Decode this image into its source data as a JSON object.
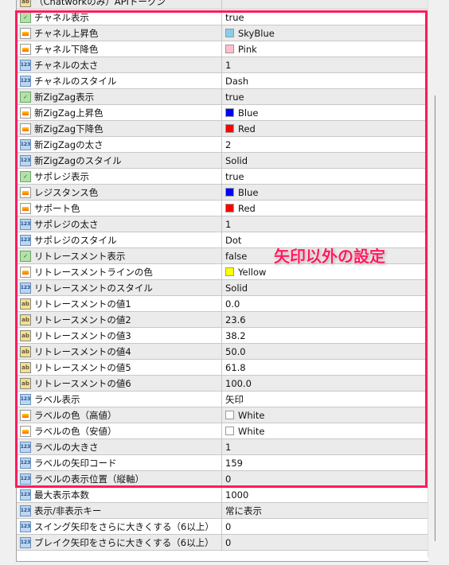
{
  "rows": [
    {
      "type": "ab",
      "name": "（Chatworkのみ）APIトークン",
      "value": ""
    },
    {
      "type": "bool",
      "name": "チャネル表示",
      "value": "true"
    },
    {
      "type": "color",
      "name": "チャネル上昇色",
      "value": "SkyBlue",
      "swatch": "#87ceeb"
    },
    {
      "type": "color",
      "name": "チャネル下降色",
      "value": "Pink",
      "swatch": "#ffc0cb"
    },
    {
      "type": "num",
      "name": "チャネルの太さ",
      "value": "1"
    },
    {
      "type": "num",
      "name": "チャネルのスタイル",
      "value": "Dash"
    },
    {
      "type": "bool",
      "name": "新ZigZag表示",
      "value": "true"
    },
    {
      "type": "color",
      "name": "新ZigZag上昇色",
      "value": "Blue",
      "swatch": "#0000ff"
    },
    {
      "type": "color",
      "name": "新ZigZag下降色",
      "value": "Red",
      "swatch": "#ff0000"
    },
    {
      "type": "num",
      "name": "新ZigZagの太さ",
      "value": "2"
    },
    {
      "type": "num",
      "name": "新ZigZagのスタイル",
      "value": "Solid"
    },
    {
      "type": "bool",
      "name": "サポレジ表示",
      "value": "true"
    },
    {
      "type": "color",
      "name": "レジスタンス色",
      "value": "Blue",
      "swatch": "#0000ff"
    },
    {
      "type": "color",
      "name": "サポート色",
      "value": "Red",
      "swatch": "#ff0000"
    },
    {
      "type": "num",
      "name": "サポレジの太さ",
      "value": "1"
    },
    {
      "type": "num",
      "name": "サポレジのスタイル",
      "value": "Dot"
    },
    {
      "type": "bool",
      "name": "リトレースメント表示",
      "value": "false"
    },
    {
      "type": "color",
      "name": "リトレースメントラインの色",
      "value": "Yellow",
      "swatch": "#ffff00"
    },
    {
      "type": "num",
      "name": "リトレースメントのスタイル",
      "value": "Solid"
    },
    {
      "type": "ab",
      "name": "リトレースメントの値1",
      "value": "0.0"
    },
    {
      "type": "ab",
      "name": "リトレースメントの値2",
      "value": "23.6"
    },
    {
      "type": "ab",
      "name": "リトレースメントの値3",
      "value": "38.2"
    },
    {
      "type": "ab",
      "name": "リトレースメントの値4",
      "value": "50.0"
    },
    {
      "type": "ab",
      "name": "リトレースメントの値5",
      "value": "61.8"
    },
    {
      "type": "ab",
      "name": "リトレースメントの値6",
      "value": "100.0"
    },
    {
      "type": "num",
      "name": "ラベル表示",
      "value": "矢印"
    },
    {
      "type": "color",
      "name": "ラベルの色（高値）",
      "value": "White",
      "swatch": "#ffffff"
    },
    {
      "type": "color",
      "name": "ラベルの色（安値）",
      "value": "White",
      "swatch": "#ffffff"
    },
    {
      "type": "num",
      "name": "ラベルの大きさ",
      "value": "1"
    },
    {
      "type": "num",
      "name": "ラベルの矢印コード",
      "value": "159"
    },
    {
      "type": "num",
      "name": "ラベルの表示位置（縦軸）",
      "value": "0"
    },
    {
      "type": "num",
      "name": "最大表示本数",
      "value": "1000"
    },
    {
      "type": "num",
      "name": "表示/非表示キー",
      "value": "常に表示"
    },
    {
      "type": "num",
      "name": "スイング矢印をさらに大きくする（6以上）",
      "value": "0"
    },
    {
      "type": "num",
      "name": "ブレイク矢印をさらに大きくする（6以上）",
      "value": "0"
    }
  ],
  "icon_labels": {
    "ab": "ab",
    "num": "123",
    "bool": "✓",
    "color": ""
  },
  "annotation": {
    "text": "矢印以外の設定",
    "color": "#ff1a5e"
  }
}
